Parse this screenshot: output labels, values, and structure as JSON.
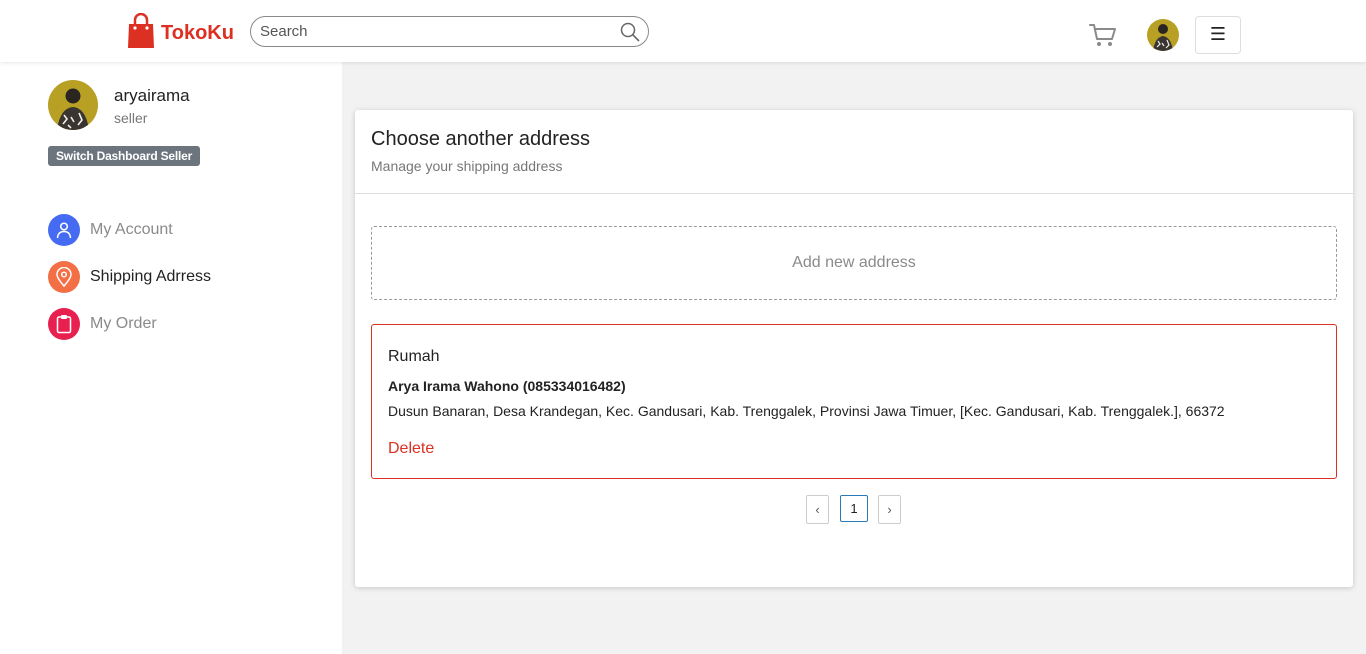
{
  "header": {
    "brand": "TokoKu",
    "brand_color": "#db3022",
    "search_placeholder": "Search",
    "search_icon": "search-icon",
    "cart_icon": "cart-icon",
    "menu_icon": "hamburger-icon",
    "menu_glyph": "☰"
  },
  "sidebar": {
    "username": "aryairama",
    "role": "seller",
    "switch_label": "Switch Dashboard Seller",
    "items": [
      {
        "label": "My Account",
        "icon": "user-icon",
        "color": "#456bf3",
        "active": false
      },
      {
        "label": "Shipping Adrress",
        "icon": "map-pin-icon",
        "color": "#f36f45",
        "active": true
      },
      {
        "label": "My Order",
        "icon": "clipboard-icon",
        "color": "#f3456f",
        "active": false
      }
    ]
  },
  "main": {
    "title": "Choose another address",
    "subtitle": "Manage your shipping address",
    "add_address_label": "Add new address",
    "addresses": [
      {
        "label": "Rumah",
        "recipient": "Arya Irama Wahono (085334016482)",
        "detail": "Dusun Banaran, Desa Krandegan, Kec. Gandusari, Kab. Trenggalek, Provinsi Jawa Timuer, [Kec. Gandusari, Kab. Trenggalek.], 66372",
        "delete_label": "Delete"
      }
    ],
    "pagination": {
      "prev": "‹",
      "current": "1",
      "next": "›"
    }
  }
}
